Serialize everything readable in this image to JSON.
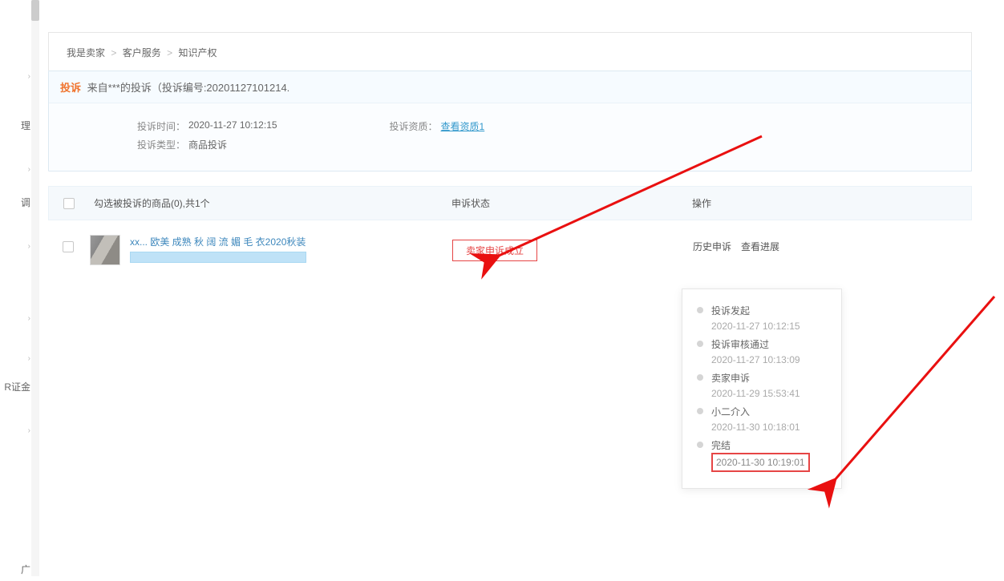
{
  "breadcrumb": {
    "a": "我是卖家",
    "b": "客户服务",
    "c": "知识产权"
  },
  "complaint": {
    "tag": "投诉",
    "head_text": "来自***的投诉（投诉编号:20201127101214.",
    "time_label": "投诉时间：",
    "time_value": "2020-11-27 10:12:15",
    "qual_label": "投诉资质：",
    "qual_link": "查看资质1",
    "type_label": "投诉类型：",
    "type_value": "商品投诉"
  },
  "sidebar": {
    "items": [
      {
        "label": ""
      },
      {
        "label": "理"
      },
      {
        "label": ""
      },
      {
        "label": "调"
      },
      {
        "label": ""
      },
      {
        "label": ""
      },
      {
        "label": ""
      },
      {
        "label": "R证金"
      },
      {
        "label": ""
      },
      {
        "label": "广"
      }
    ]
  },
  "table": {
    "head_product": "勾选被投诉的商品(0),共1个",
    "head_status": "申诉状态",
    "head_action": "操作",
    "row": {
      "title_partial": "xx... 欧美 成熟 秋 阔 流 媚 毛 衣2020秋装",
      "status": "卖家申诉成立",
      "action_history": "历史申诉",
      "action_view": "查看进展"
    }
  },
  "timeline": [
    {
      "title": "投诉发起",
      "time": "2020-11-27 10:12:15"
    },
    {
      "title": "投诉审核通过",
      "time": "2020-11-27 10:13:09"
    },
    {
      "title": "卖家申诉",
      "time": "2020-11-29 15:53:41"
    },
    {
      "title": "小二介入",
      "time": "2020-11-30 10:18:01"
    },
    {
      "title": "完结",
      "time": "2020-11-30 10:19:01",
      "hl": true
    }
  ]
}
